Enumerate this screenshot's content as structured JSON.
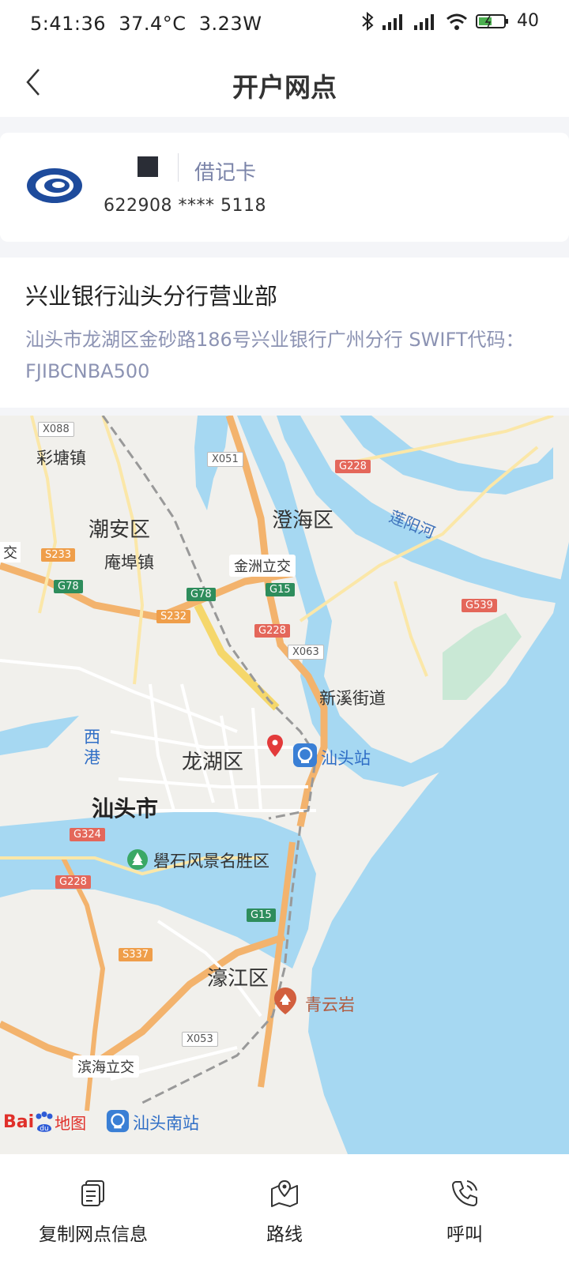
{
  "status_bar": {
    "time": "5:41:36",
    "temperature": "37.4°C",
    "power": "3.23W",
    "battery": "40"
  },
  "nav": {
    "title": "开户网点"
  },
  "card": {
    "type": "借记卡",
    "number": "622908 **** 5118"
  },
  "branch": {
    "name": "兴业银行汕头分行营业部",
    "address": "汕头市龙湖区金砂路186号兴业银行广州分行 SWIFT代码：FJIBCNBA500"
  },
  "map": {
    "places": {
      "caitang": "彩塘镇",
      "chaoan": "潮安区",
      "anbu": "庵埠镇",
      "chenghai": "澄海区",
      "jinzhou": "金洲立交",
      "xinxi": "新溪街道",
      "longhu": "龙湖区",
      "shantou_city": "汕头市",
      "shantou_station": "汕头站",
      "xigang": "西港",
      "queshi": "礐石风景名胜区",
      "haojiang": "濠江区",
      "qingyunyan": "青云岩",
      "binhai": "滨海立交",
      "shantou_south": "汕头南站",
      "lianyang": "莲阳河",
      "edge_jiao": "交"
    },
    "roads": {
      "x088": "X088",
      "x051": "X051",
      "g228a": "G228",
      "s233": "S233",
      "g78a": "G78",
      "g78b": "G78",
      "g15a": "G15",
      "s232": "S232",
      "g228b": "G228",
      "x063": "X063",
      "g539": "G539",
      "g324": "G324",
      "g228c": "G228",
      "g15b": "G15",
      "s337": "S337",
      "x053": "X053"
    },
    "logo_text": "地图"
  },
  "actions": {
    "copy": "复制网点信息",
    "route": "路线",
    "call": "呼叫"
  }
}
